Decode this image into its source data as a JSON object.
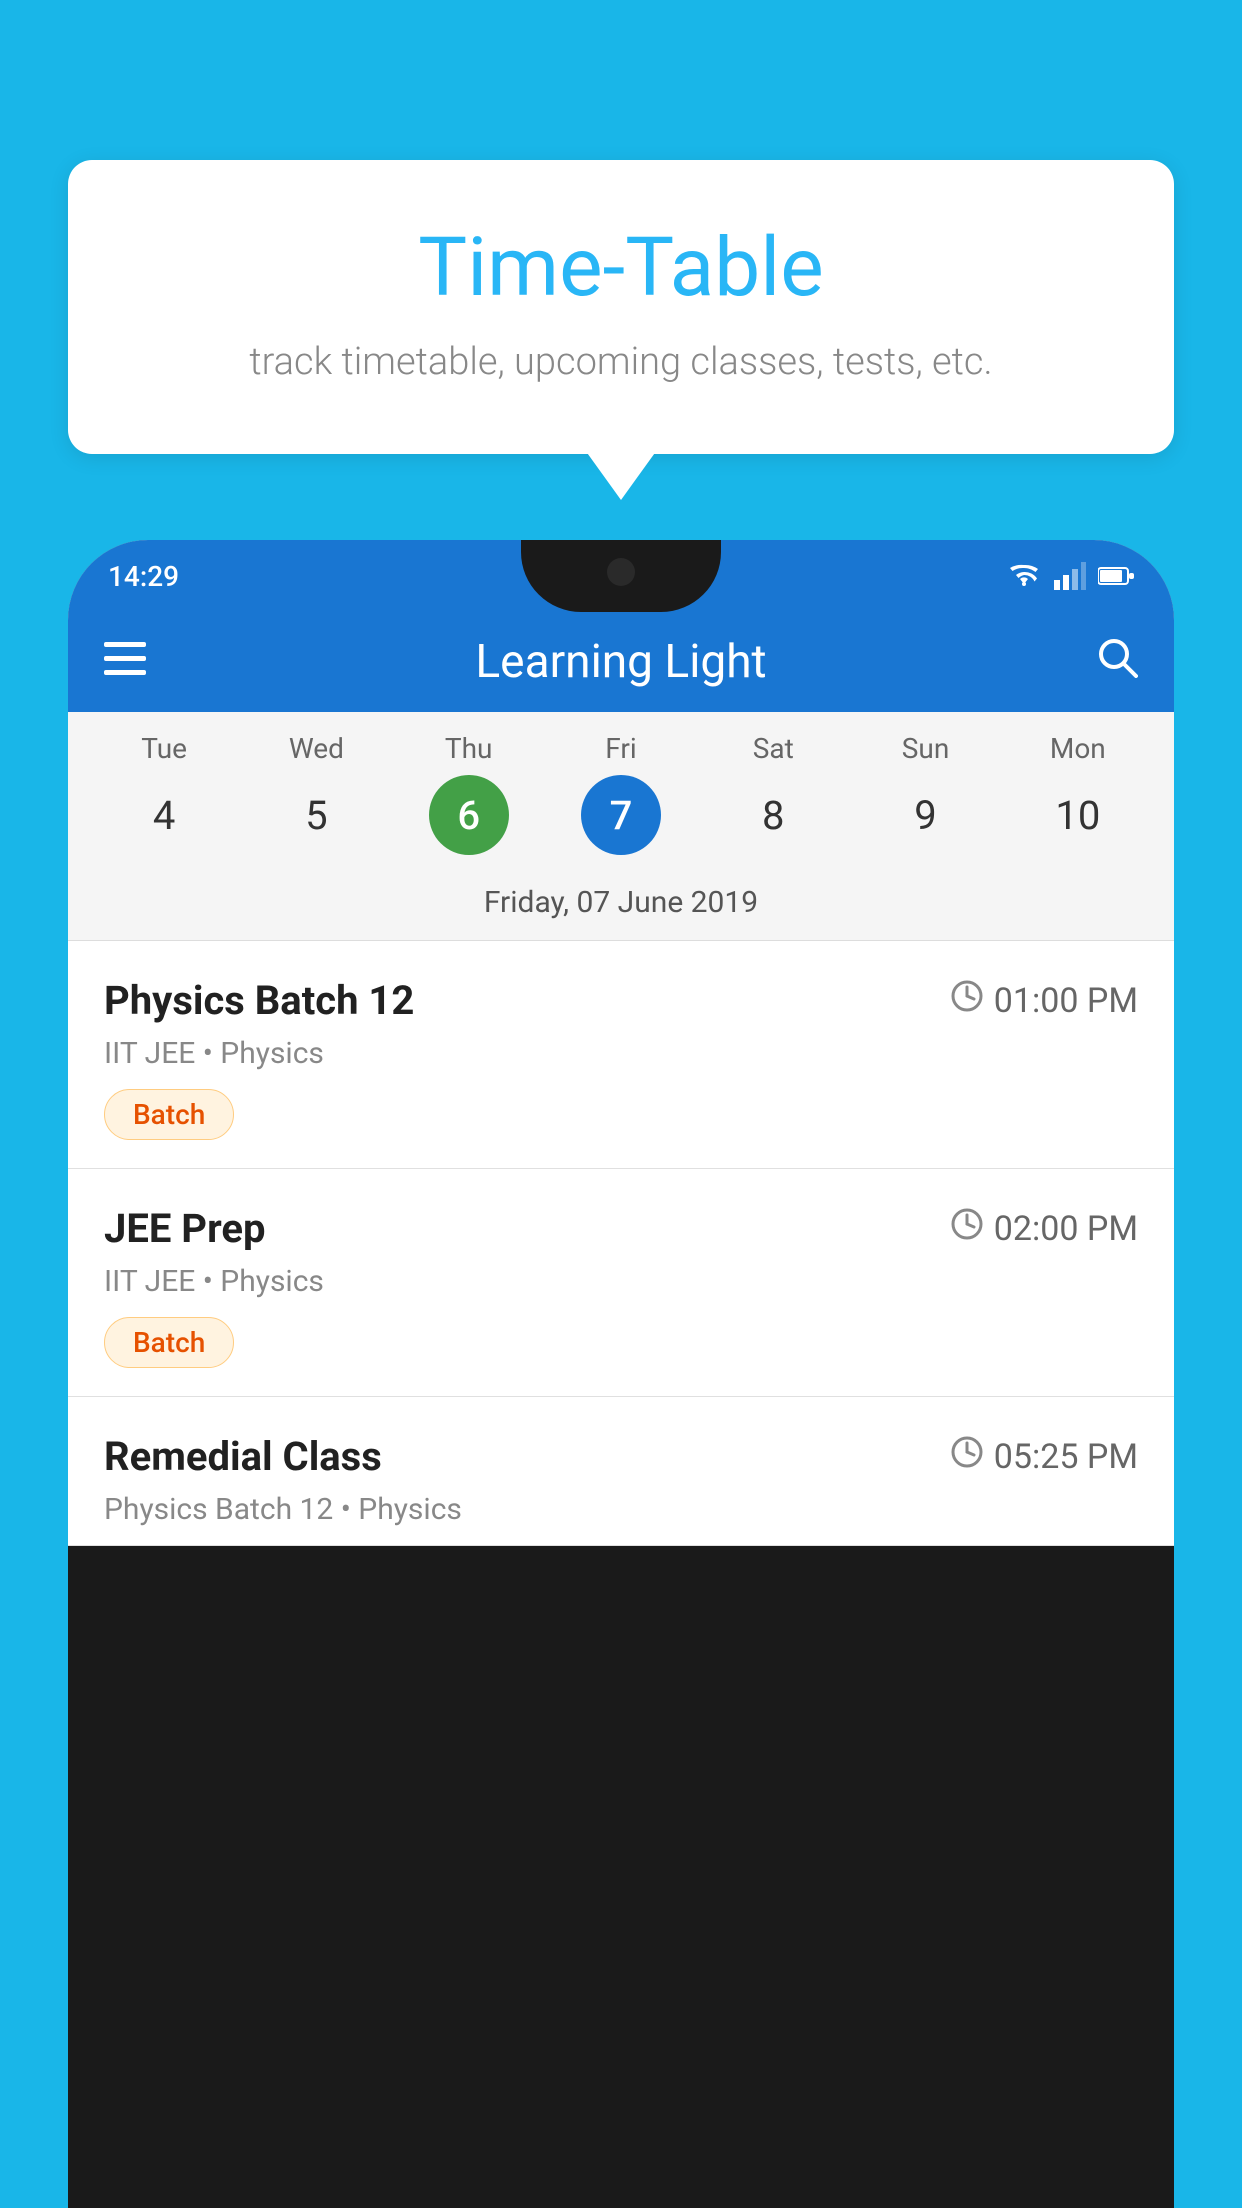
{
  "page": {
    "background_color": "#19b6e8"
  },
  "tooltip": {
    "title": "Time-Table",
    "subtitle": "track timetable, upcoming classes, tests, etc."
  },
  "phone": {
    "status_bar": {
      "time": "14:29"
    },
    "app_bar": {
      "title": "Learning Light"
    },
    "calendar": {
      "days": [
        {
          "label": "Tue",
          "number": "4"
        },
        {
          "label": "Wed",
          "number": "5"
        },
        {
          "label": "Thu",
          "number": "6",
          "state": "today"
        },
        {
          "label": "Fri",
          "number": "7",
          "state": "selected"
        },
        {
          "label": "Sat",
          "number": "8"
        },
        {
          "label": "Sun",
          "number": "9"
        },
        {
          "label": "Mon",
          "number": "10"
        }
      ],
      "selected_date_label": "Friday, 07 June 2019"
    },
    "schedule": [
      {
        "title": "Physics Batch 12",
        "time": "01:00 PM",
        "subtitle": "IIT JEE • Physics",
        "badge": "Batch"
      },
      {
        "title": "JEE Prep",
        "time": "02:00 PM",
        "subtitle": "IIT JEE • Physics",
        "badge": "Batch"
      },
      {
        "title": "Remedial Class",
        "time": "05:25 PM",
        "subtitle": "Physics Batch 12 • Physics",
        "badge": null
      }
    ]
  }
}
